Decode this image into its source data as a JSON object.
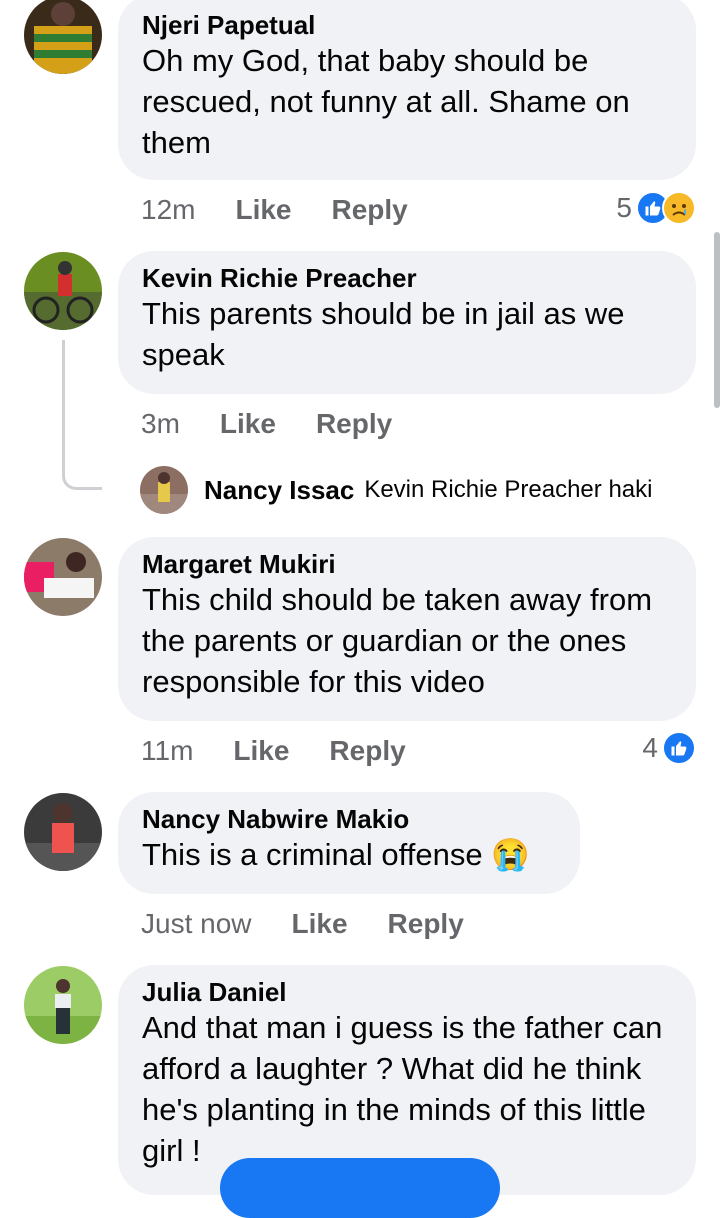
{
  "comments": [
    {
      "author": "Njeri Papetual",
      "text": "Oh my God,  that baby should be rescued,  not funny at all. Shame on them",
      "time": "12m",
      "like": "Like",
      "reply": "Reply",
      "reaction_count": "5"
    },
    {
      "author": "Kevin Richie Preacher",
      "text": "This parents should be in jail as we speak",
      "time": "3m",
      "like": "Like",
      "reply": "Reply"
    },
    {
      "author": "Margaret Mukiri",
      "text": "This child should be taken away from the parents or guardian or the ones responsible for this video",
      "time": "11m",
      "like": "Like",
      "reply": "Reply",
      "reaction_count": "4"
    },
    {
      "author": "Nancy Nabwire Makio",
      "text": "This is a criminal offense 😭",
      "time": "Just now",
      "like": "Like",
      "reply": "Reply"
    },
    {
      "author": "Julia Daniel",
      "text": "And that man i guess is the father can afford a laughter ? What did he think he's planting in the minds of this little girl !"
    }
  ],
  "reply_preview": {
    "author": "Nancy Issac",
    "text": "Kevin Richie Preacher haki"
  },
  "colors": {
    "bubble": "#f0f2f5",
    "secondary_text": "#65676b",
    "like_blue": "#1877f2",
    "sad_yellow": "#f7b928"
  }
}
